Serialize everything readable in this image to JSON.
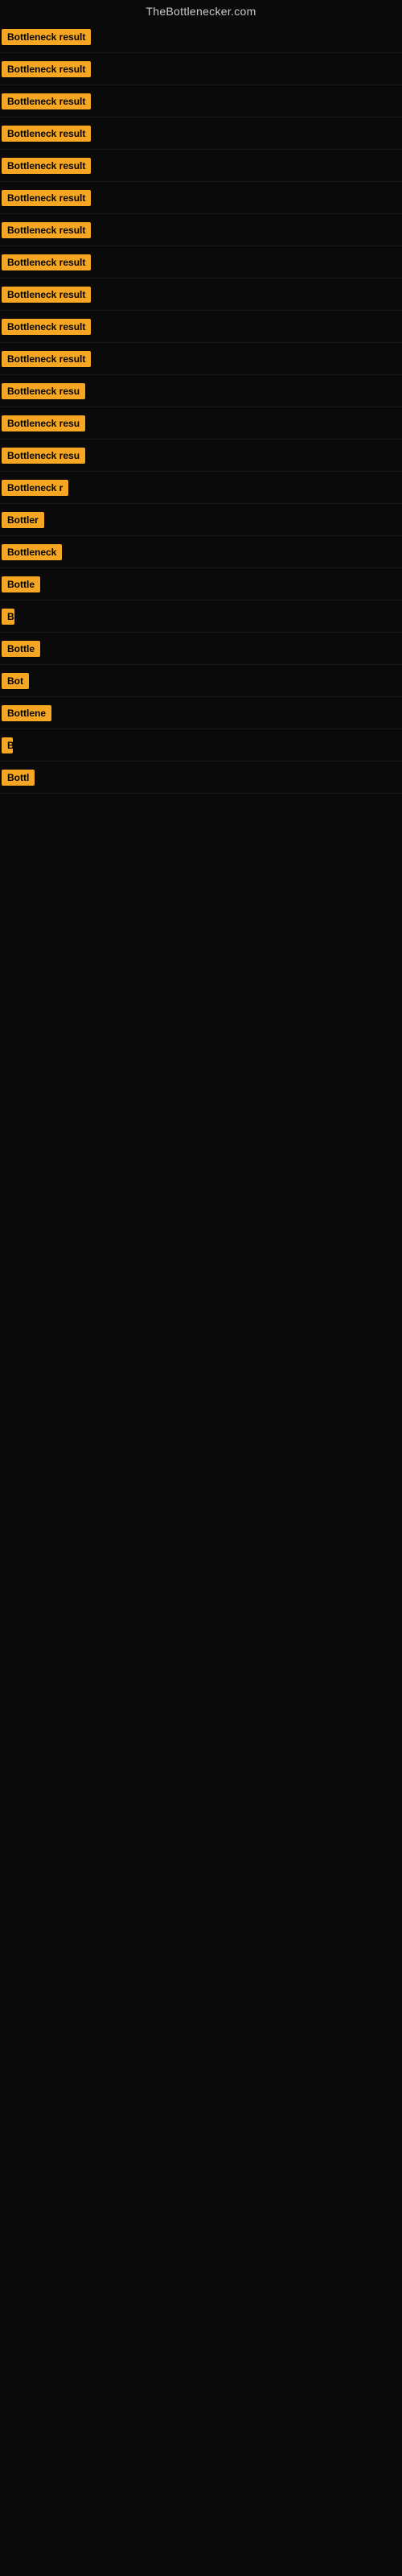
{
  "site": {
    "title": "TheBottlenecker.com"
  },
  "rows": [
    {
      "id": 1,
      "badge": "Bottleneck result",
      "width": 160
    },
    {
      "id": 2,
      "badge": "Bottleneck result",
      "width": 155
    },
    {
      "id": 3,
      "badge": "Bottleneck result",
      "width": 155
    },
    {
      "id": 4,
      "badge": "Bottleneck result",
      "width": 152
    },
    {
      "id": 5,
      "badge": "Bottleneck result",
      "width": 152
    },
    {
      "id": 6,
      "badge": "Bottleneck result",
      "width": 150
    },
    {
      "id": 7,
      "badge": "Bottleneck result",
      "width": 148
    },
    {
      "id": 8,
      "badge": "Bottleneck result",
      "width": 145
    },
    {
      "id": 9,
      "badge": "Bottleneck result",
      "width": 143
    },
    {
      "id": 10,
      "badge": "Bottleneck result",
      "width": 140
    },
    {
      "id": 11,
      "badge": "Bottleneck result",
      "width": 135
    },
    {
      "id": 12,
      "badge": "Bottleneck resu",
      "width": 118
    },
    {
      "id": 13,
      "badge": "Bottleneck resu",
      "width": 115
    },
    {
      "id": 14,
      "badge": "Bottleneck resu",
      "width": 112
    },
    {
      "id": 15,
      "badge": "Bottleneck r",
      "width": 95
    },
    {
      "id": 16,
      "badge": "Bottler",
      "width": 60
    },
    {
      "id": 17,
      "badge": "Bottleneck",
      "width": 78
    },
    {
      "id": 18,
      "badge": "Bottle",
      "width": 52
    },
    {
      "id": 19,
      "badge": "B",
      "width": 16
    },
    {
      "id": 20,
      "badge": "Bottle",
      "width": 52
    },
    {
      "id": 21,
      "badge": "Bot",
      "width": 35
    },
    {
      "id": 22,
      "badge": "Bottlene",
      "width": 65
    },
    {
      "id": 23,
      "badge": "B",
      "width": 14
    },
    {
      "id": 24,
      "badge": "Bottl",
      "width": 45
    }
  ],
  "colors": {
    "badge_bg": "#f5a623",
    "badge_text": "#000000",
    "background": "#0a0a0a",
    "title_text": "#cccccc"
  }
}
